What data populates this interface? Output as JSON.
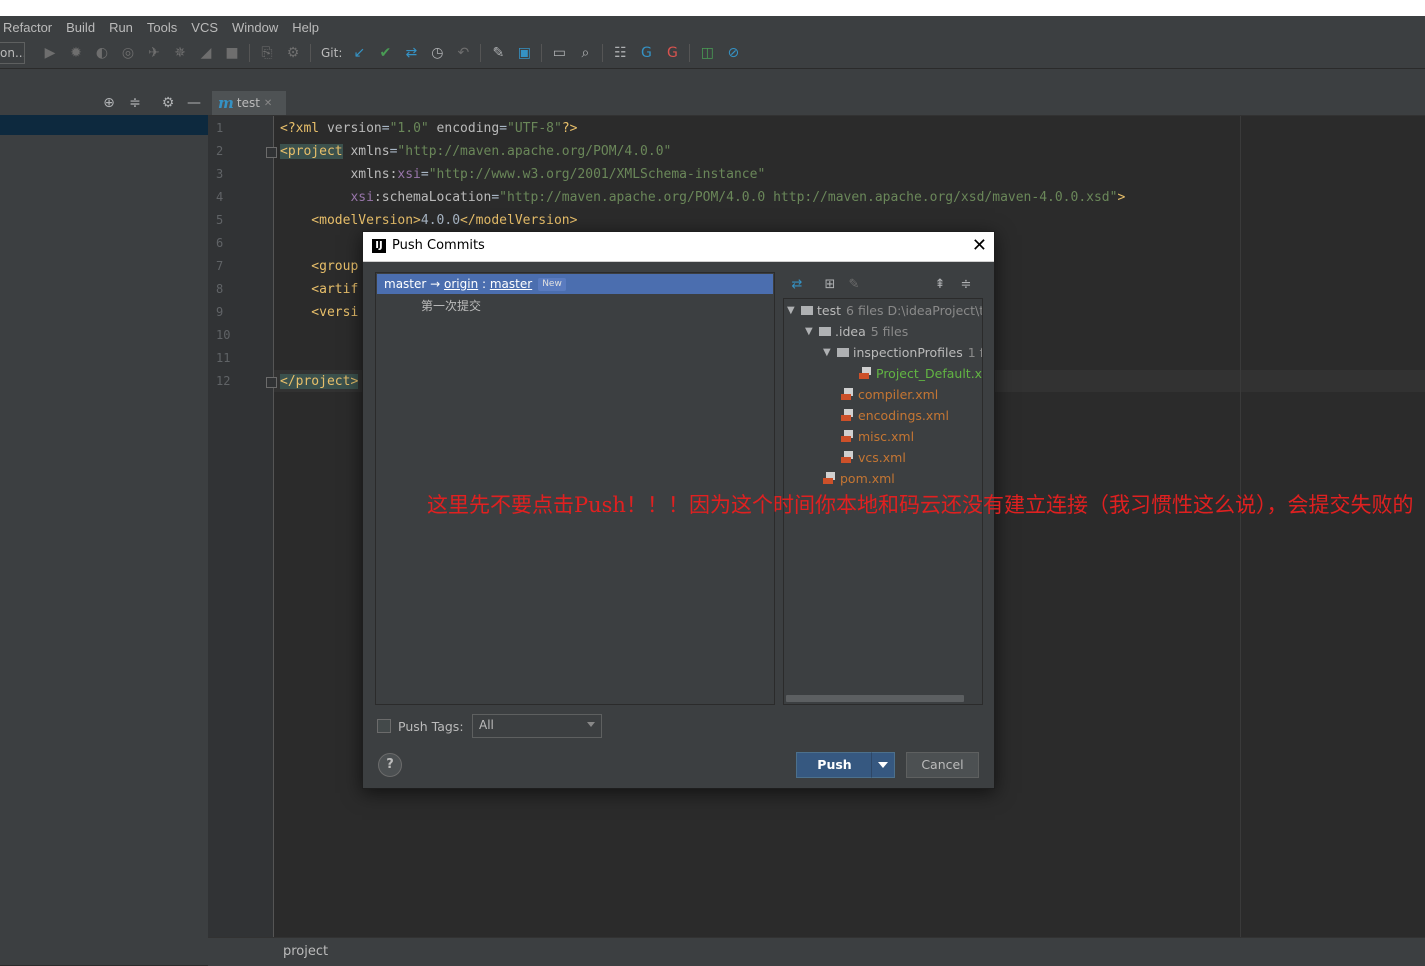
{
  "menu": [
    "Refactor",
    "Build",
    "Run",
    "Tools",
    "VCS",
    "Window",
    "Help"
  ],
  "toolbar": {
    "run_config": "on...",
    "git_label": "Git:"
  },
  "editor_tab": {
    "label": "test"
  },
  "editor": {
    "line_numbers": [
      "1",
      "2",
      "3",
      "4",
      "5",
      "6",
      "7",
      "8",
      "9",
      "10",
      "11",
      "12"
    ],
    "lines": {
      "l1": {
        "decl_open": "<?xml ",
        "attr1": "version",
        "eq": "=",
        "val1": "\"1.0\"",
        "attr2": " encoding",
        "val2": "\"UTF-8\"",
        "decl_close": "?>"
      },
      "l2": {
        "tag": "<project",
        "attr": " xmlns",
        "val": "\"http://maven.apache.org/POM/4.0.0\""
      },
      "l3": {
        "attr": "         xmlns:",
        "ns": "xsi",
        "val": "\"http://www.w3.org/2001/XMLSchema-instance\""
      },
      "l4": {
        "ns": "         xsi",
        "attr": ":schemaLocation",
        "val": "\"http://maven.apache.org/POM/4.0.0 http://maven.apache.org/xsd/maven-4.0.0.xsd\"",
        "close": ">"
      },
      "l5": {
        "open": "    <modelVersion>",
        "text": "4.0.0",
        "close": "</modelVersion>"
      },
      "l7": "    <group",
      "l8": "    <artif",
      "l9": "    <versi",
      "l12": "</project>"
    }
  },
  "status_bar": {
    "label": "project"
  },
  "dialog": {
    "title": "Push Commits",
    "close_glyph": "✕",
    "branch": {
      "local": "master",
      "arrow": " → ",
      "remote": "origin",
      "sep": " : ",
      "target": "master",
      "badge": "New"
    },
    "commits": [
      "第一次提交"
    ],
    "tree": [
      {
        "name": "test",
        "meta": "6 files  D:\\ideaProject\\t"
      },
      {
        "name": ".idea",
        "meta": "5 files"
      },
      {
        "name": "inspectionProfiles",
        "meta": "1 f"
      },
      {
        "name": "Project_Default.xml"
      },
      {
        "name": "compiler.xml"
      },
      {
        "name": "encodings.xml"
      },
      {
        "name": "misc.xml"
      },
      {
        "name": "vcs.xml"
      },
      {
        "name": "pom.xml"
      }
    ],
    "push_tags_label": "Push Tags:",
    "push_tags_value": "All",
    "help_glyph": "?",
    "push_label": "Push",
    "cancel_label": "Cancel"
  },
  "annotation": "这里先不要点击Push！！！因为这个时间你本地和码云还没有建立连接（我习惯性这么说），会提交失败的",
  "colors": {
    "editor_bg": "#2b2b2b",
    "panel_bg": "#3c3f41",
    "selection": "#4b6eaf",
    "primary_button": "#365880",
    "annotation_red": "#e02020",
    "file_new_green": "#62b543",
    "file_orange": "#c57633"
  }
}
